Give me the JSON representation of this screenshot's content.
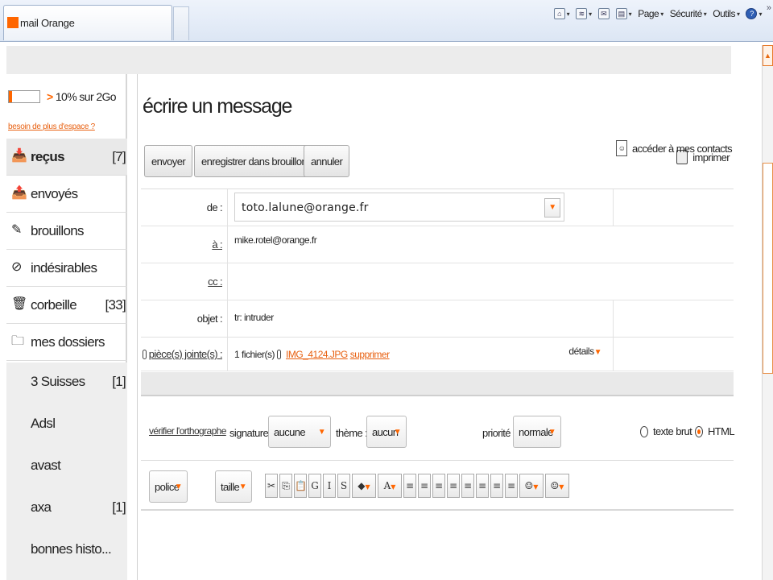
{
  "browser": {
    "tab_title": "mail Orange",
    "tools": [
      {
        "icon": "home-icon",
        "label": ""
      },
      {
        "icon": "rss-icon",
        "label": ""
      },
      {
        "icon": "mail-icon",
        "label": ""
      },
      {
        "icon": "printer-icon",
        "label": ""
      },
      {
        "icon": "page-icon",
        "label": "Page"
      },
      {
        "icon": "security-icon",
        "label": "Sécurité"
      },
      {
        "icon": "tools-icon",
        "label": "Outils"
      },
      {
        "icon": "help-icon",
        "label": ""
      }
    ],
    "more": "»"
  },
  "sidebar": {
    "quota": {
      "text": "10% sur 2Go",
      "arrow": ">",
      "fraction": 0.1
    },
    "space_link": "besoin de plus d'espace ?",
    "folders": [
      {
        "label": "reçus",
        "count": "[7]",
        "icon": "inbox-icon",
        "active": true
      },
      {
        "label": "envoyés",
        "count": "",
        "icon": "sent-icon",
        "active": false
      },
      {
        "label": "brouillons",
        "count": "",
        "icon": "drafts-icon",
        "active": false
      },
      {
        "label": "indésirables",
        "count": "",
        "icon": "spam-icon",
        "active": false
      },
      {
        "label": "corbeille",
        "count": "[33]",
        "icon": "trash-icon",
        "active": false
      },
      {
        "label": "mes dossiers",
        "count": "",
        "icon": "folder-icon",
        "active": false
      }
    ],
    "subfolders": [
      {
        "label": "3 Suisses",
        "count": "[1]"
      },
      {
        "label": "Adsl",
        "count": ""
      },
      {
        "label": "avast",
        "count": ""
      },
      {
        "label": "axa",
        "count": "[1]"
      },
      {
        "label": "bonnes histo...",
        "count": ""
      }
    ]
  },
  "compose": {
    "title": "écrire un message",
    "buttons": {
      "send": "envoyer",
      "save_draft": "enregistrer dans brouillons",
      "cancel": "annuler"
    },
    "print": "imprimer",
    "fields": {
      "from_label": "de :",
      "from_value": "toto.lalune@orange.fr",
      "to_label": "à :",
      "to_value": "mike.rotel@orange.fr",
      "cc_label": "cc :",
      "cc_value": "",
      "subject_label": "objet :",
      "subject_value": "tr: intruder",
      "attach_label": "pièce(s) jointe(s) :",
      "attach_count": "1 fichier(s)",
      "attach_file": "IMG_4124.JPG",
      "attach_remove": "supprimer",
      "details": "détails"
    },
    "contacts_link": "accéder à mes contacts",
    "options": {
      "spellcheck": "vérifier l'orthographe",
      "signature_label": "signature :",
      "signature_value": "aucune",
      "theme_label": "thème :",
      "theme_value": "aucun",
      "priority_label": "priorité :",
      "priority_value": "normale",
      "plain_text": "texte brut",
      "html": "HTML"
    },
    "toolbar": {
      "font": "police",
      "size": "taille",
      "buttons": [
        {
          "icon": "cut-icon",
          "glyph": "✂"
        },
        {
          "icon": "copy-icon",
          "glyph": "⎘"
        },
        {
          "icon": "paste-icon",
          "glyph": "📋"
        },
        {
          "icon": "bold-icon",
          "glyph": "G"
        },
        {
          "icon": "italic-icon",
          "glyph": "I"
        },
        {
          "icon": "strike-icon",
          "glyph": "S"
        },
        {
          "icon": "highlight-icon",
          "glyph": "◆"
        },
        {
          "icon": "text-color-icon",
          "glyph": "A"
        },
        {
          "icon": "numbered-list-icon",
          "glyph": "≡"
        },
        {
          "icon": "bullet-list-icon",
          "glyph": "≡"
        },
        {
          "icon": "outdent-icon",
          "glyph": "≡"
        },
        {
          "icon": "indent-icon",
          "glyph": "≡"
        },
        {
          "icon": "align-left-icon",
          "glyph": "≡"
        },
        {
          "icon": "align-center-icon",
          "glyph": "≡"
        },
        {
          "icon": "align-right-icon",
          "glyph": "≡"
        },
        {
          "icon": "justify-icon",
          "glyph": "≡"
        },
        {
          "icon": "image-icon",
          "glyph": "☺"
        },
        {
          "icon": "smiley-icon",
          "glyph": "☺"
        }
      ]
    }
  },
  "colors": {
    "accent": "#ff6600",
    "active_folder": "#e9e9e9"
  }
}
